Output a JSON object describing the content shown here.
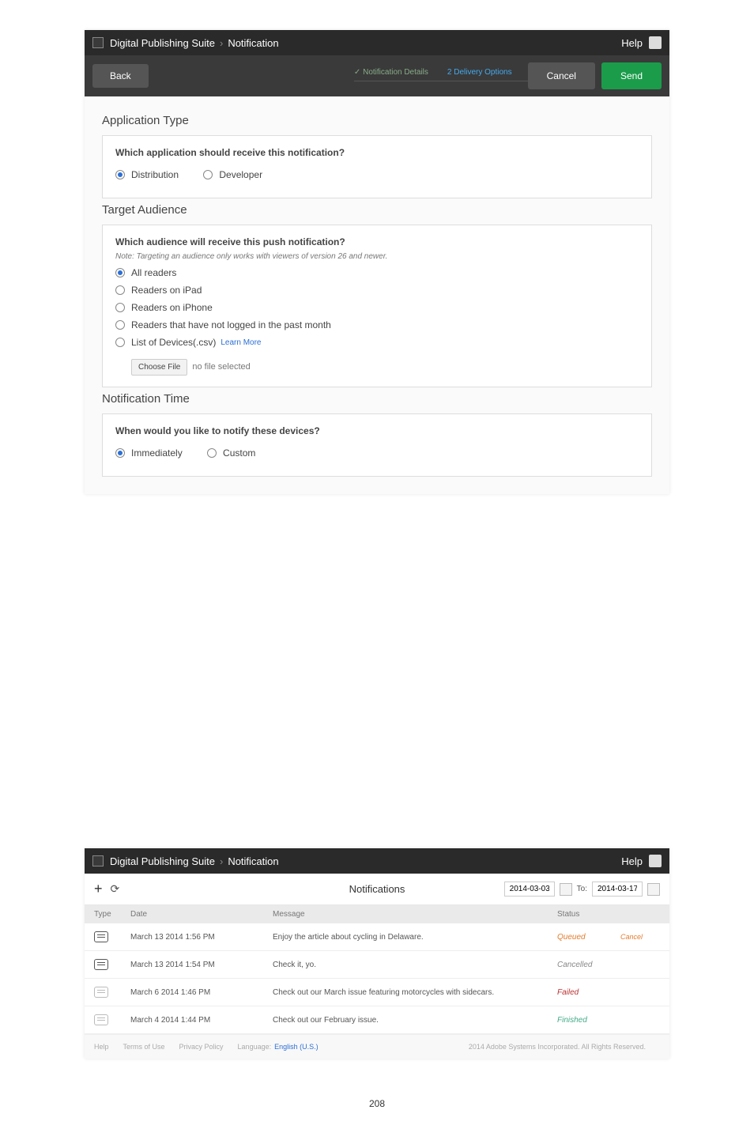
{
  "page_number": "208",
  "screen1": {
    "breadcrumb": {
      "app": "Digital Publishing Suite",
      "page": "Notification"
    },
    "help": "Help",
    "back": "Back",
    "step_done": "Notification Details",
    "step_active": "Delivery Options",
    "step_active_num": "2",
    "cancel": "Cancel",
    "send": "Send",
    "app_type": {
      "title": "Application Type",
      "q": "Which application should receive this notification?",
      "opt1": "Distribution",
      "opt2": "Developer"
    },
    "audience": {
      "title": "Target Audience",
      "q": "Which audience will receive this push notification?",
      "note": "Note: Targeting an audience only works with viewers of version 26 and newer.",
      "opt1": "All readers",
      "opt2": "Readers on iPad",
      "opt3": "Readers on iPhone",
      "opt4": "Readers that have not logged in the past month",
      "opt5": "List of Devices(.csv)",
      "learn": "Learn More",
      "choose": "Choose File",
      "nofile": "no file selected"
    },
    "time": {
      "title": "Notification Time",
      "q": "When would you like to notify these devices?",
      "opt1": "Immediately",
      "opt2": "Custom"
    }
  },
  "screen2": {
    "breadcrumb": {
      "app": "Digital Publishing Suite",
      "page": "Notification"
    },
    "help": "Help",
    "title": "Notifications",
    "date_from": "2014-03-03",
    "to": "To:",
    "date_to": "2014-03-17",
    "cols": {
      "type": "Type",
      "date": "Date",
      "msg": "Message",
      "status": "Status"
    },
    "rows": [
      {
        "date": "March 13 2014 1:56 PM",
        "msg": "Enjoy the article about cycling in Delaware.",
        "status": "Queued",
        "status_class": "status-q",
        "icon": "dark",
        "action": "Cancel"
      },
      {
        "date": "March 13 2014 1:54 PM",
        "msg": "Check it, yo.",
        "status": "Cancelled",
        "status_class": "status-c",
        "icon": "dark",
        "action": ""
      },
      {
        "date": "March 6 2014 1:46 PM",
        "msg": "Check out our March issue featuring motorcycles with sidecars.",
        "status": "Failed",
        "status_class": "status-f",
        "icon": "light",
        "action": ""
      },
      {
        "date": "March 4 2014 1:44 PM",
        "msg": "Check out our February issue.",
        "status": "Finished",
        "status_class": "status-d",
        "icon": "light",
        "action": ""
      }
    ],
    "footer": {
      "help": "Help",
      "terms": "Terms of Use",
      "privacy": "Privacy Policy",
      "lang_label": "Language:",
      "lang": "English (U.S.)",
      "copy": "2014 Adobe Systems Incorporated. All Rights Reserved."
    }
  }
}
